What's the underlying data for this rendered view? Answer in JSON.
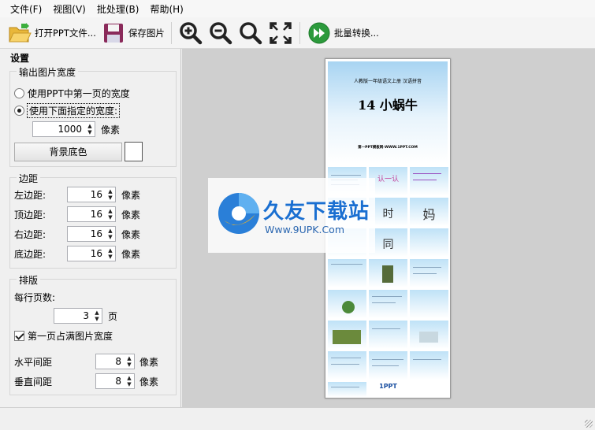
{
  "menu": {
    "items": [
      "文件(F)",
      "视图(V)",
      "批处理(B)",
      "帮助(H)"
    ]
  },
  "toolbar": {
    "open_label": "打开PPT文件...",
    "save_label": "保存图片",
    "batch_label": "批量转换..."
  },
  "settings": {
    "title": "设置",
    "width_group": {
      "title": "输出图片宽度",
      "option1": "使用PPT中第一页的宽度",
      "option2": "使用下面指定的宽度:",
      "selected": 2,
      "width_value": "1000",
      "unit": "像素",
      "bg_button": "背景底色",
      "bg_color": "#ffffff"
    },
    "margin_group": {
      "title": "边距",
      "unit": "像素",
      "rows": [
        {
          "label": "左边距:",
          "value": "16"
        },
        {
          "label": "顶边距:",
          "value": "16"
        },
        {
          "label": "右边距:",
          "value": "16"
        },
        {
          "label": "底边距:",
          "value": "16"
        }
      ]
    },
    "layout_group": {
      "title": "排版",
      "per_row_label": "每行页数:",
      "per_row_value": "3",
      "per_row_unit": "页",
      "fill_first_label": "第一页占满图片宽度",
      "fill_first_checked": true,
      "h_gap_label": "水平间距",
      "h_gap_value": "8",
      "v_gap_label": "垂直间距",
      "v_gap_value": "8",
      "unit": "像素"
    }
  },
  "preview": {
    "cover_subtitle": "人教版一年级语文上册   汉语拼音",
    "cover_title": "14 小蜗牛",
    "cover_source": "第一PPT模板网-WWW.1PPT.COM",
    "thumb_texts": [
      "认一认",
      "妈",
      "时",
      "同",
      "1PPT"
    ],
    "watermark_title": "久友下载站",
    "watermark_url": "Www.9UPK.Com"
  },
  "colors": {
    "accent": "#1a6fd1",
    "canvas": "#cfcfcf",
    "panel": "#f0f0f0"
  }
}
